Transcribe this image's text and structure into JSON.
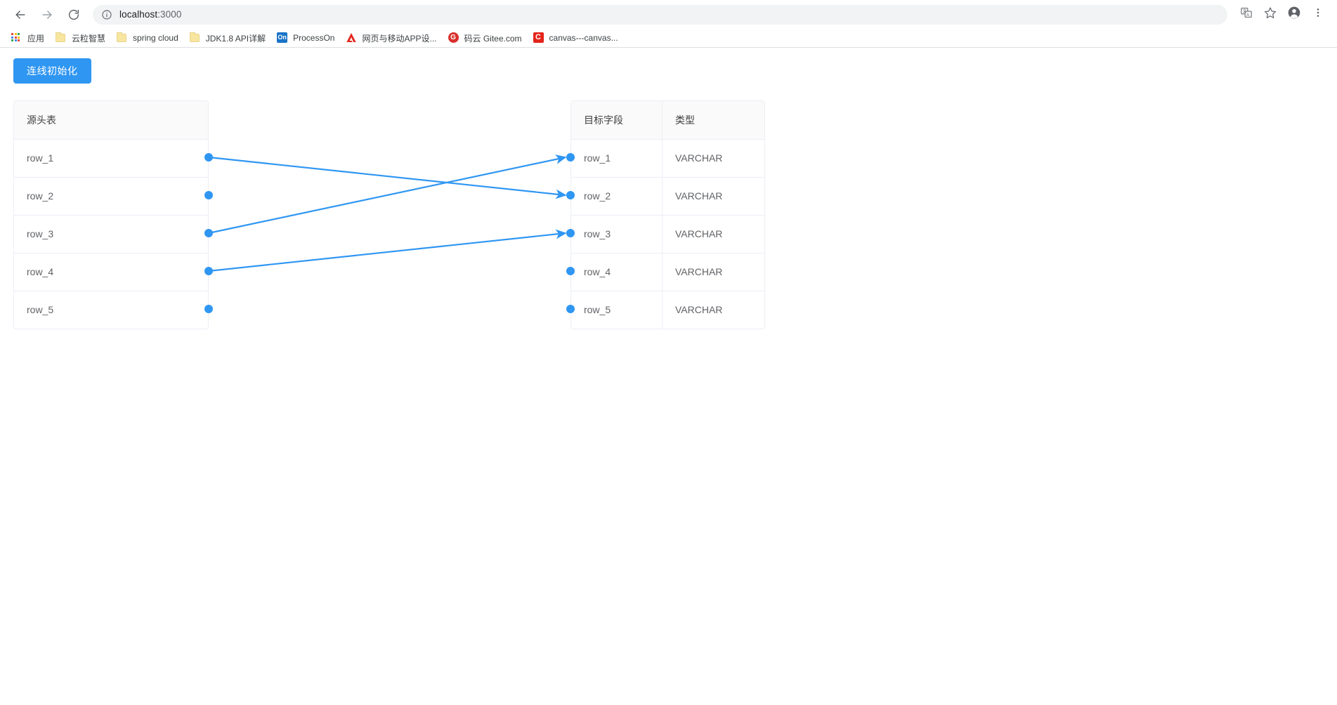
{
  "browser": {
    "back_icon": "back-arrow-icon",
    "forward_icon": "forward-arrow-icon",
    "reload_icon": "reload-icon",
    "site_info_icon": "info-circle-icon",
    "url_host": "localhost",
    "url_path": ":3000",
    "url_full": "localhost:3000",
    "translate_icon": "translate-icon",
    "bookmark_star_icon": "star-icon",
    "profile_icon": "profile-avatar-icon",
    "menu_icon": "three-dot-menu-icon"
  },
  "bookmarks": [
    {
      "label": "应用",
      "icon": "apps-grid-icon",
      "type": "apps"
    },
    {
      "label": "云粒智慧",
      "icon": "folder-icon",
      "type": "folder"
    },
    {
      "label": "spring cloud",
      "icon": "folder-icon",
      "type": "folder"
    },
    {
      "label": "JDK1.8 API详解",
      "icon": "folder-icon",
      "type": "folder"
    },
    {
      "label": "ProcessOn",
      "icon": "processon-icon",
      "type": "square",
      "glyph": "On",
      "color": "#1a73c8"
    },
    {
      "label": "网页与移动APP设...",
      "icon": "adobe-xd-icon",
      "type": "adobe",
      "glyph": "A",
      "color": "#e3241b"
    },
    {
      "label": "码云 Gitee.com",
      "icon": "gitee-icon",
      "type": "circle",
      "glyph": "G",
      "color": "#d9302c"
    },
    {
      "label": "canvas---canvas...",
      "icon": "canvas-icon",
      "type": "letter-red",
      "glyph": "C",
      "color": "#e3241b"
    }
  ],
  "page": {
    "init_button_label": "连线初始化",
    "source_table": {
      "header": "源头表",
      "rows": [
        {
          "name": "row_1"
        },
        {
          "name": "row_2"
        },
        {
          "name": "row_3"
        },
        {
          "name": "row_4"
        },
        {
          "name": "row_5"
        }
      ]
    },
    "target_table": {
      "headers": [
        "目标字段",
        "类型"
      ],
      "rows": [
        {
          "name": "row_1",
          "type": "VARCHAR"
        },
        {
          "name": "row_2",
          "type": "VARCHAR"
        },
        {
          "name": "row_3",
          "type": "VARCHAR"
        },
        {
          "name": "row_4",
          "type": "VARCHAR"
        },
        {
          "name": "row_5",
          "type": "VARCHAR"
        }
      ]
    },
    "connections": [
      {
        "from": "row_1",
        "to": "row_2"
      },
      {
        "from": "row_3",
        "to": "row_1"
      },
      {
        "from": "row_4",
        "to": "row_3"
      }
    ],
    "anchor_color": "#2f96f2",
    "line_color": "#2f96f2",
    "accent_color": "#2f96f2"
  }
}
